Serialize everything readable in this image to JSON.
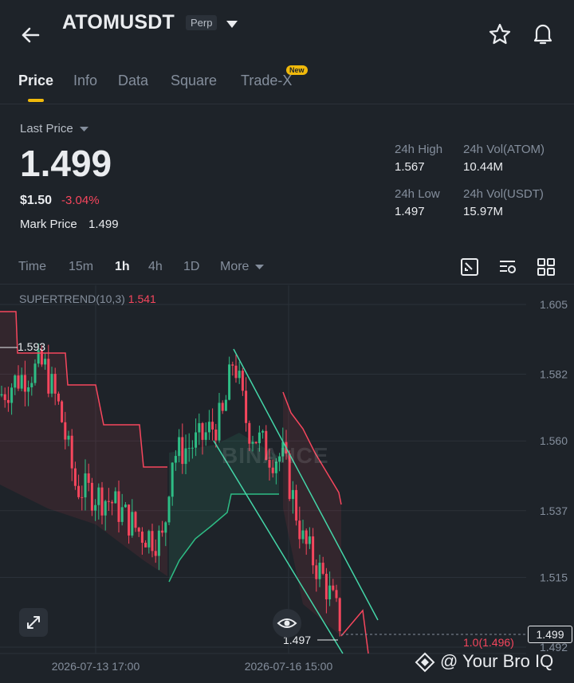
{
  "header": {
    "symbol": "ATOMUSDT",
    "badge": "Perp",
    "icons": [
      "back-arrow-icon",
      "caret-down-icon",
      "star-icon",
      "bell-icon"
    ]
  },
  "tabs": {
    "items": [
      "Price",
      "Info",
      "Data",
      "Square",
      "Trade-X"
    ],
    "active": "Price",
    "new_badge": "New"
  },
  "price": {
    "last_price_label": "Last Price",
    "last_price": "1.499",
    "usd_price": "$1.50",
    "change": "-3.04%",
    "mark_price_label": "Mark Price",
    "mark_price": "1.499"
  },
  "stats": {
    "high_label": "24h High",
    "high": "1.567",
    "low_label": "24h Low",
    "low": "1.497",
    "vol_atom_label": "24h Vol(ATOM)",
    "vol_atom": "10.44M",
    "vol_usdt_label": "24h Vol(USDT)",
    "vol_usdt": "15.97M"
  },
  "timeframes": {
    "items": [
      "Time",
      "15m",
      "1h",
      "4h",
      "1D",
      "More"
    ],
    "active": "1h"
  },
  "chart": {
    "indicator_label": "SUPERTREND(10,3)",
    "indicator_value": "1.541",
    "y_ticks": [
      "1.605",
      "1.582",
      "1.560",
      "1.537",
      "1.515",
      "1.492"
    ],
    "x_ticks": [
      "2026-07-13 17:00",
      "2026-07-16 15:00"
    ],
    "high_marker": "1.593",
    "low_marker": "1.497",
    "last_price_tag": "1.499",
    "fib_label": "1.0(1.496)",
    "watermark": "BINANCE",
    "brand": "@ Your Bro IQ",
    "colors": {
      "up": "#2ebd85",
      "down": "#f6465d",
      "accent": "#f0b90b",
      "channel": "#44d6a8"
    }
  }
}
